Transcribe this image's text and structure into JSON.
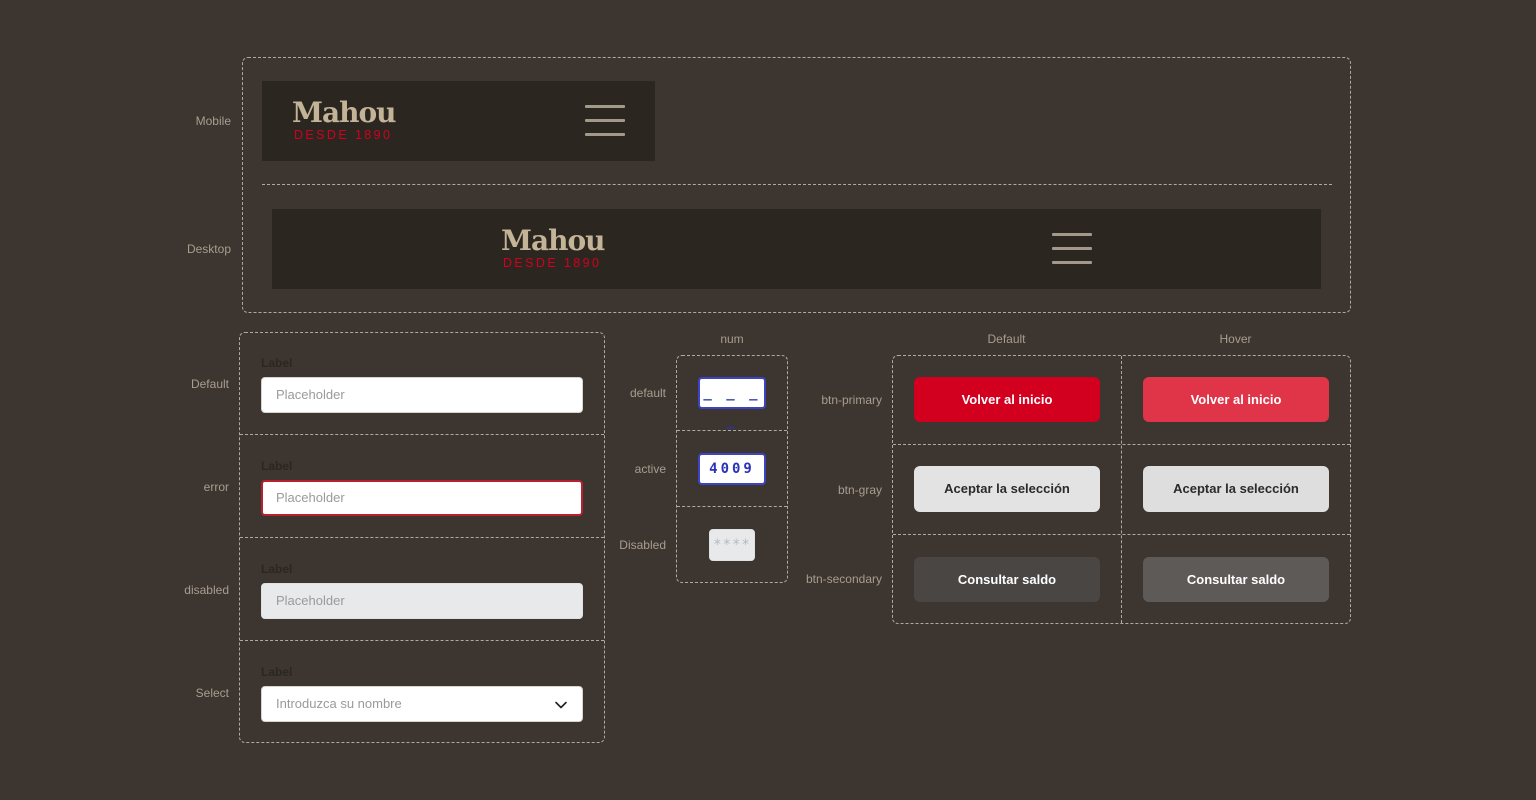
{
  "header_section": {
    "mobile_label": "Mobile",
    "desktop_label": "Desktop",
    "logo_word": "Mahou",
    "logo_sub": "DESDE 1890"
  },
  "inputs_section": {
    "rows": [
      {
        "state": "Default",
        "label": "Label",
        "placeholder": "Placeholder"
      },
      {
        "state": "error",
        "label": "Label",
        "placeholder": "Placeholder"
      },
      {
        "state": "disabled",
        "label": "Label",
        "placeholder": "Placeholder"
      },
      {
        "state": "Select",
        "label": "Label",
        "placeholder": "Introduzca su nombre"
      }
    ]
  },
  "num_section": {
    "column": "num",
    "rows": [
      {
        "state": "default",
        "value": "_ _ _ _"
      },
      {
        "state": "active",
        "value": "4009"
      },
      {
        "state": "Disabled",
        "value": "****"
      }
    ]
  },
  "buttons_section": {
    "columns": [
      "Default",
      "Hover"
    ],
    "rows": [
      {
        "name": "btn-primary",
        "label": "Volver al inicio"
      },
      {
        "name": "btn-gray",
        "label": "Aceptar la selección"
      },
      {
        "name": "btn-secondary",
        "label": "Consultar saldo"
      }
    ]
  },
  "colors": {
    "background": "#3d3530",
    "navbar": "#2c2621",
    "brand_red": "#d2001e",
    "brand_gold": "#c3b397",
    "num_blue": "#3c44c5"
  },
  "icons": [
    "hamburger-menu-icon",
    "chevron-down-icon"
  ]
}
